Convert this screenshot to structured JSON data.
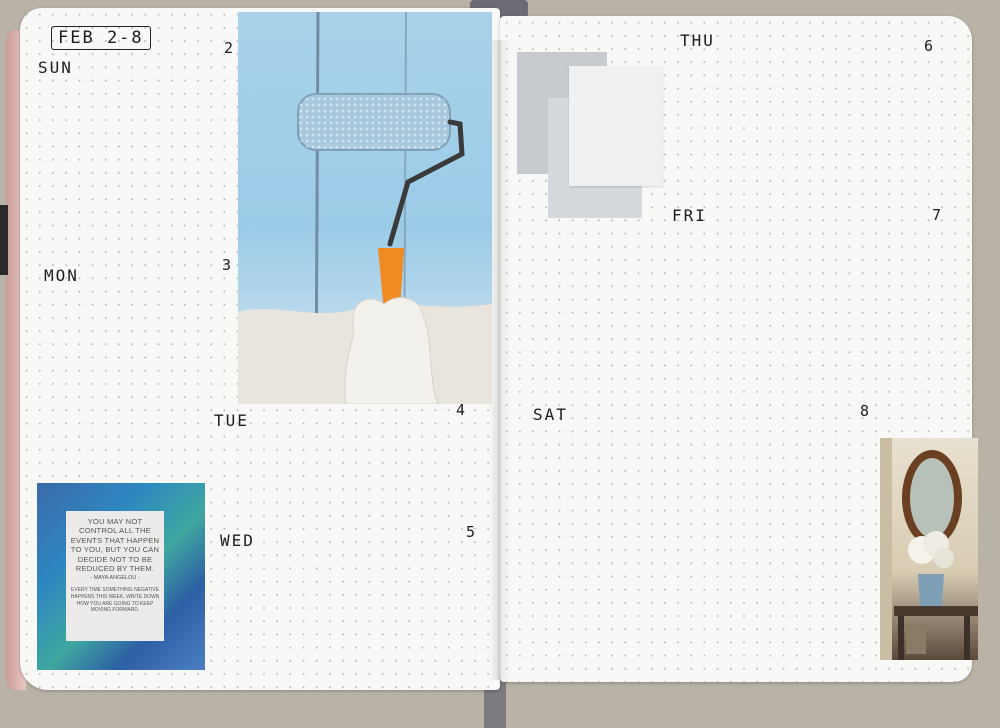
{
  "week": {
    "label": "FEB 2-8"
  },
  "days": [
    {
      "name": "SUN",
      "date": "2"
    },
    {
      "name": "MON",
      "date": "3"
    },
    {
      "name": "TUE",
      "date": "4"
    },
    {
      "name": "WED",
      "date": "5"
    },
    {
      "name": "THU",
      "date": "6"
    },
    {
      "name": "FRI",
      "date": "7"
    },
    {
      "name": "SAT",
      "date": "8"
    }
  ],
  "quote_card": {
    "quote": "YOU MAY NOT CONTROL ALL THE EVENTS THAT HAPPEN TO YOU, BUT YOU CAN DECIDE NOT TO BE REDUCED BY THEM.",
    "author": "- MAYA ANGELOU -",
    "prompt": "EVERY TIME SOMETHING NEGATIVE HAPPENS THIS WEEK, WRITE DOWN HOW YOU ARE GOING TO KEEP MOVING FORWARD."
  },
  "colors": {
    "page": "#f8f8f6",
    "ink": "#1d1d1d",
    "cover_pink": "#e9c8c6",
    "paint_blue": "#9ccbe7",
    "roller_handle": "#f08a22",
    "swatch_grey_1": "#c7cbcf",
    "swatch_grey_2": "#d5d9dd",
    "swatch_white": "#eef1f0"
  },
  "images": [
    {
      "name": "paint-roller-photo",
      "subject": "hand painting a wall light blue with a roller"
    },
    {
      "name": "paint-swatches",
      "subject": "three grey paint color swatches"
    },
    {
      "name": "mirror-photo",
      "subject": "round wooden mirror above console table with flower vase"
    }
  ]
}
